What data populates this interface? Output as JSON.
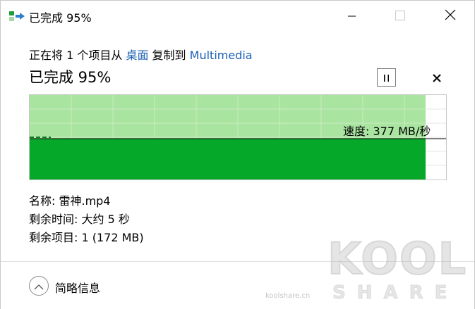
{
  "window": {
    "title": "已完成 95%",
    "icon": "copy-progress-icon",
    "controls": {
      "minimize": "minimize-icon",
      "maximize": "maximize-icon",
      "close": "close-icon"
    }
  },
  "header": {
    "prefix": "正在将 1 个项目从 ",
    "source": "桌面",
    "middle": " 复制到 ",
    "destination": "Multimedia",
    "progress_title": "已完成 95%",
    "progress_percent": 95,
    "pause_icon": "pause-icon",
    "cancel_icon": "cancel-icon"
  },
  "graph": {
    "speed_label": "速度: 377 MB/秒",
    "colors": {
      "done_fill": "#06a82a",
      "history_fill": "#a9e5a0",
      "grid": "#d4efd0",
      "speed_line": "#000000"
    }
  },
  "details": {
    "name": "名称: 雷神.mp4",
    "time_remaining": "剩余时间: 大约 5 秒",
    "items_remaining": "剩余项目: 1 (172 MB)"
  },
  "footer": {
    "collapse_icon": "chevron-up-icon",
    "collapse_label": "简略信息"
  },
  "watermark": {
    "brand": "KOOL",
    "brand_sub": "SHARE",
    "site": "koolshare.cn"
  }
}
